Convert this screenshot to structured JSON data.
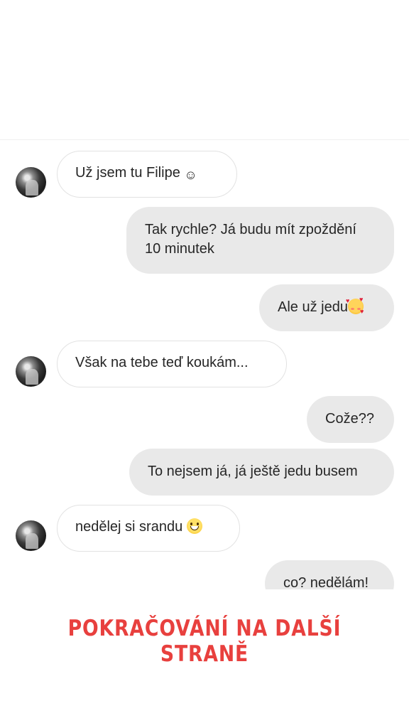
{
  "messages": [
    {
      "sender": "them",
      "text": "Už jsem tu Filipe ",
      "emoji": "slightly-smiling-face-icon"
    },
    {
      "sender": "me",
      "text": "Tak rychle? Já budu mít zpoždění 10 minutek"
    },
    {
      "sender": "me",
      "text": "Ale už jedu",
      "emoji": "smiling-face-with-hearts-icon"
    },
    {
      "sender": "them",
      "text": "Však na tebe teď koukám..."
    },
    {
      "sender": "me",
      "text": "Cože??"
    },
    {
      "sender": "me",
      "text": "To nejsem já, já ještě jedu busem"
    },
    {
      "sender": "them",
      "text": "nedělej si srandu ",
      "emoji": "grinning-face-icon"
    },
    {
      "sender": "me",
      "text": "co? nedělám!"
    }
  ],
  "banner": {
    "text": "POKRAČOVÁNÍ NA DALŠÍ STRANĚ",
    "color": "#e8403e"
  },
  "colors": {
    "incoming_bubble_bg": "#ffffff",
    "incoming_bubble_border": "#e2e2e2",
    "outgoing_bubble_bg": "#e9e9e9",
    "text": "#262626"
  }
}
